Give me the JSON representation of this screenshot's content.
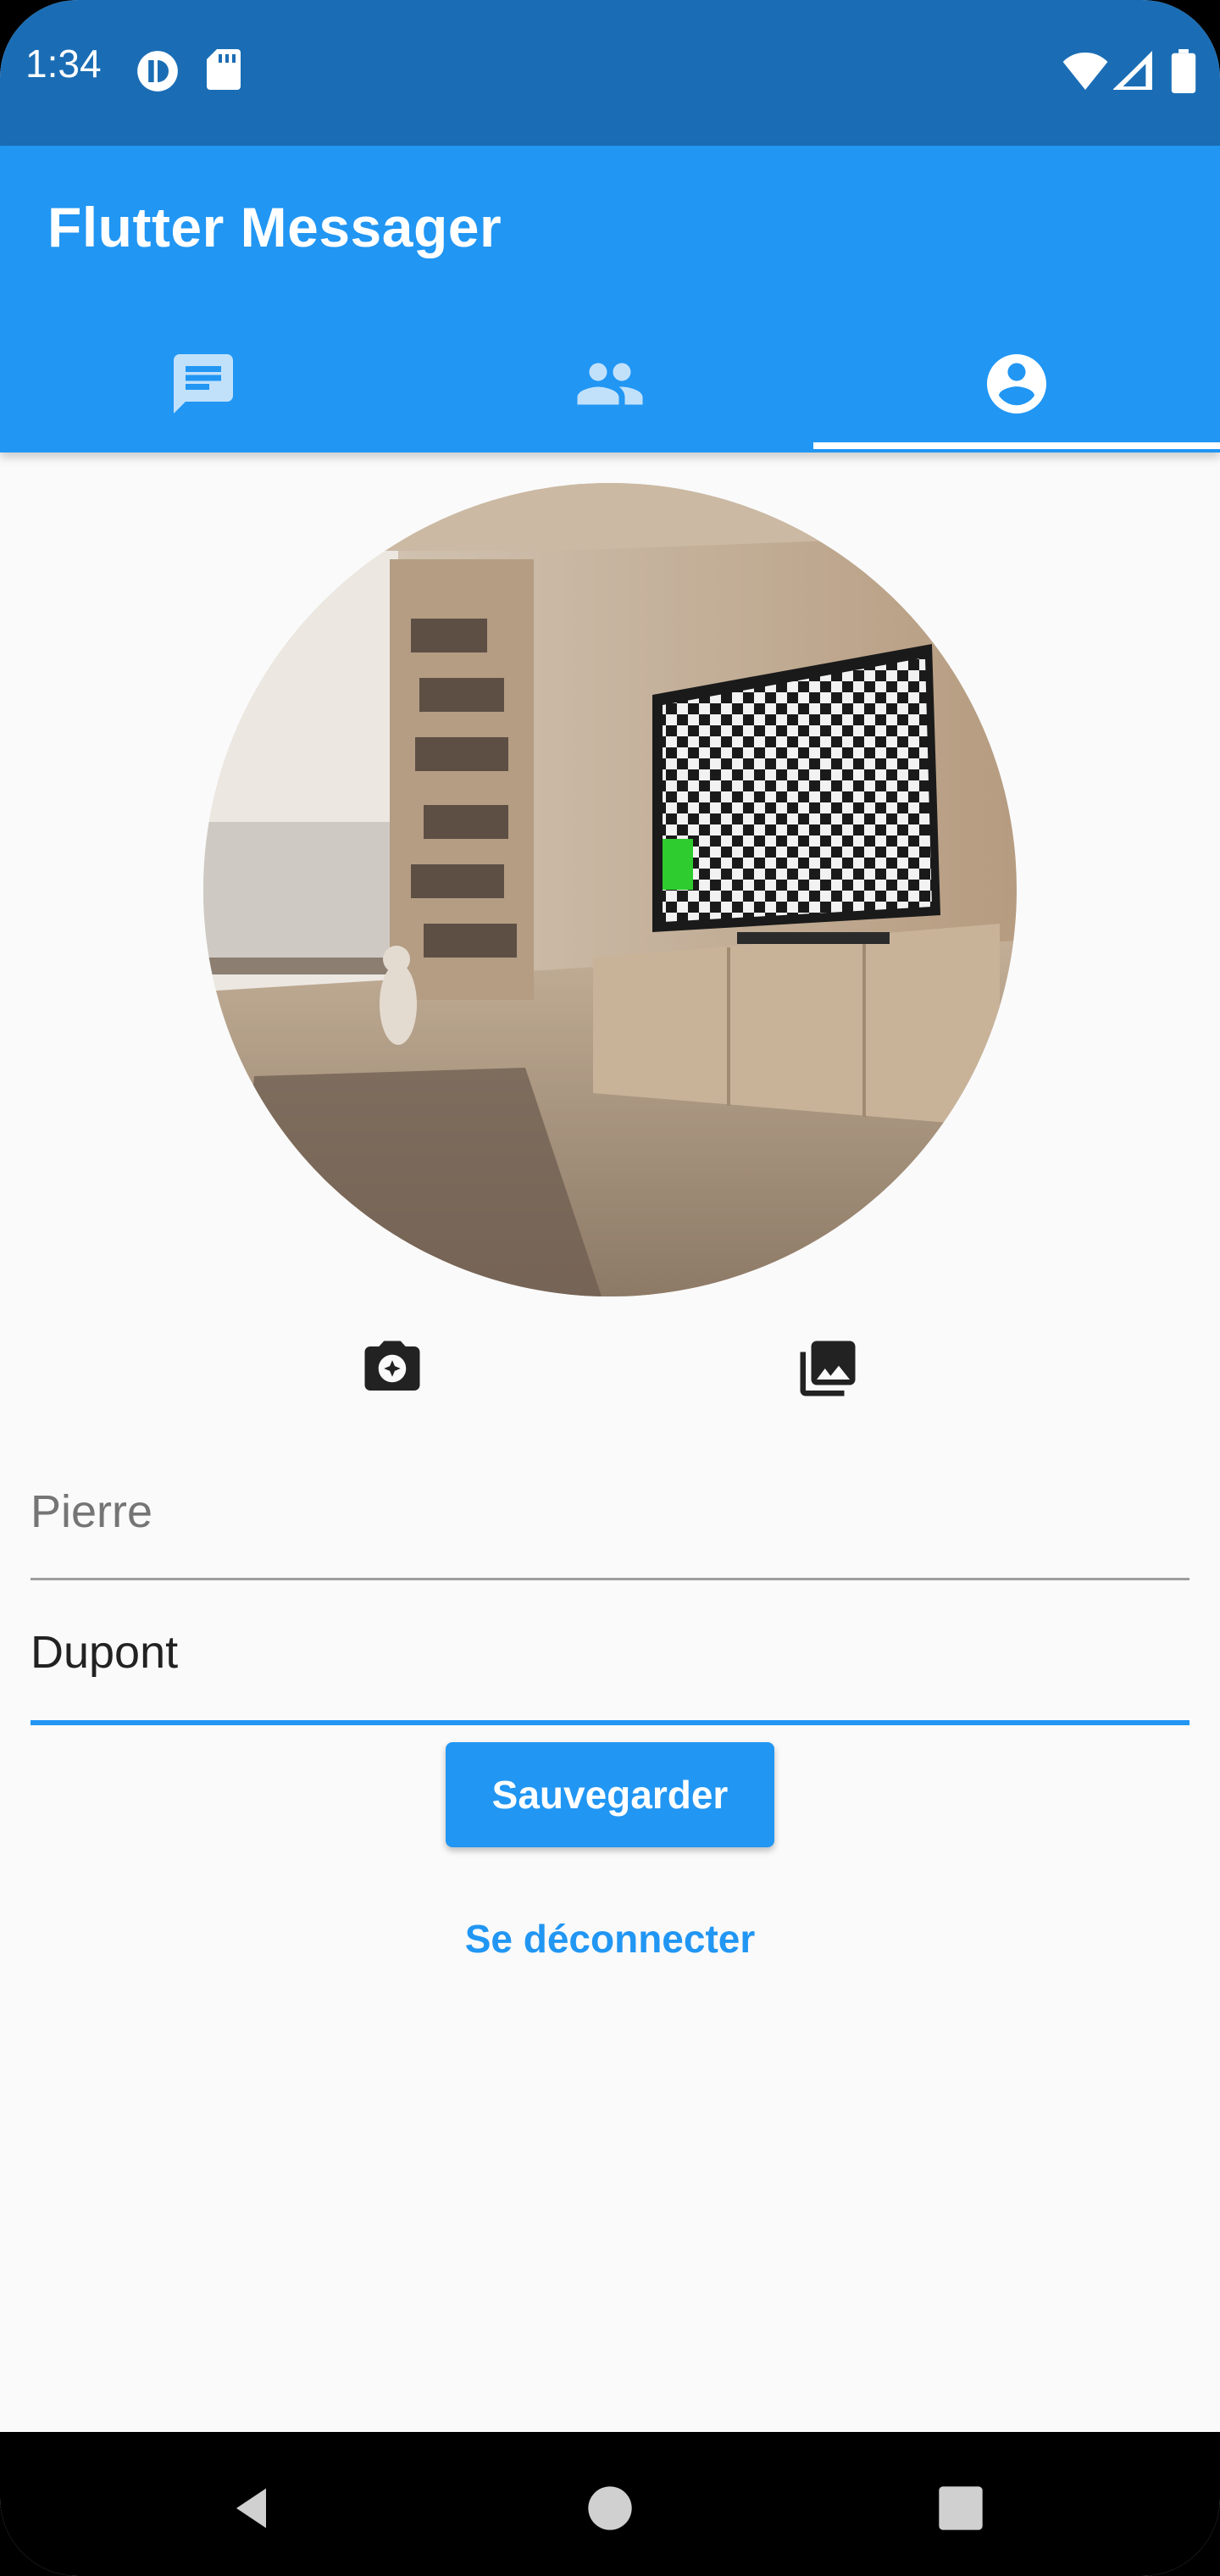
{
  "status_bar": {
    "time": "1:34",
    "left_icons": [
      "pressure-icon",
      "sd-card-icon"
    ],
    "right_icons": [
      "wifi-icon",
      "signal-icon",
      "battery-icon"
    ]
  },
  "app_bar": {
    "title": "Flutter Messager",
    "tabs": [
      {
        "icon": "chat-icon",
        "selected": false
      },
      {
        "icon": "people-icon",
        "selected": false
      },
      {
        "icon": "account-circle-icon",
        "selected": true
      }
    ],
    "color": "#2196f3"
  },
  "profile": {
    "image": "room-photo",
    "actions": [
      {
        "icon": "camera-icon"
      },
      {
        "icon": "photo-library-icon"
      }
    ]
  },
  "form": {
    "first_name": {
      "value": "",
      "placeholder": "Pierre"
    },
    "last_name": {
      "value": "Dupont",
      "placeholder": ""
    },
    "save_label": "Sauvegarder",
    "logout_label": "Se déconnecter"
  },
  "nav_bar": {
    "buttons": [
      "back-icon",
      "home-icon",
      "recents-icon"
    ]
  }
}
